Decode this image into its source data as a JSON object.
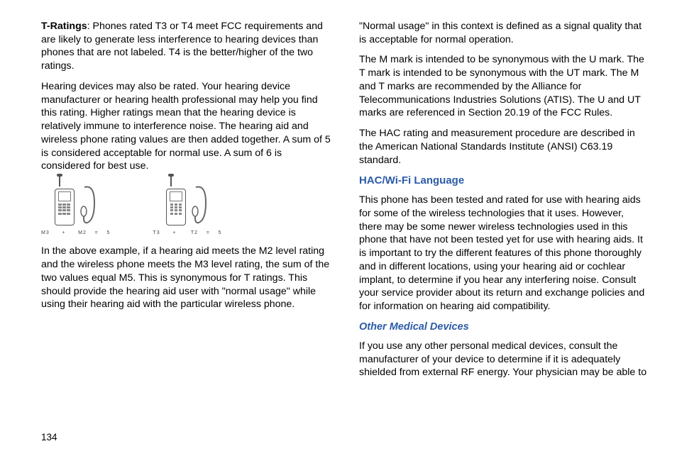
{
  "pageNumber": "134",
  "left": {
    "p1_bold": "T-Ratings",
    "p1_rest": ": Phones rated T3 or T4 meet FCC requirements and are likely to generate less interference to hearing devices than phones that are not labeled. T4 is the better/higher of the two ratings.",
    "p2": "Hearing devices may also be rated. Your hearing device manufacturer or hearing health professional may help you find this rating. Higher ratings mean that the hearing device is relatively immune to interference noise. The hearing aid and wireless phone rating values are then added together. A sum of 5 is considered acceptable for normal use. A sum of 6 is considered for best use.",
    "caption1": "M3      +      M2    =    5",
    "caption2": "T3      +       T2    =    5",
    "p3": "In the above example, if a hearing aid meets the M2 level rating and the wireless phone meets the M3 level rating, the sum of the two values equal M5. This is synonymous for T ratings. This should provide the hearing aid user with \"normal usage\" while using their hearing aid with the particular wireless phone."
  },
  "right": {
    "p1": "\"Normal usage\" in this context is defined as a signal quality that is acceptable for normal operation.",
    "p2": "The M mark is intended to be synonymous with the U mark. The T mark is intended to be synonymous with the UT mark. The M and T marks are recommended by the Alliance for Telecommunications Industries Solutions (ATIS). The U and UT marks are referenced in Section 20.19 of the FCC Rules.",
    "p3": "The HAC rating and measurement procedure are described in the American National Standards Institute (ANSI) C63.19 standard.",
    "h1": "HAC/Wi-Fi Language",
    "p4": "This phone has been tested and rated for use with hearing aids for some of the wireless technologies that it uses. However, there may be some newer wireless technologies used in this phone that have not been tested yet for use with hearing aids. It is important to try the different features of this phone thoroughly and in different locations, using your hearing aid or cochlear implant, to determine if you hear any interfering noise. Consult your service provider about its return and exchange policies and for information on hearing aid compatibility.",
    "h2": "Other Medical Devices",
    "p5": "If you use any other personal medical devices, consult the manufacturer of your device to determine if it is adequately shielded from external RF energy. Your physician may be able to"
  }
}
